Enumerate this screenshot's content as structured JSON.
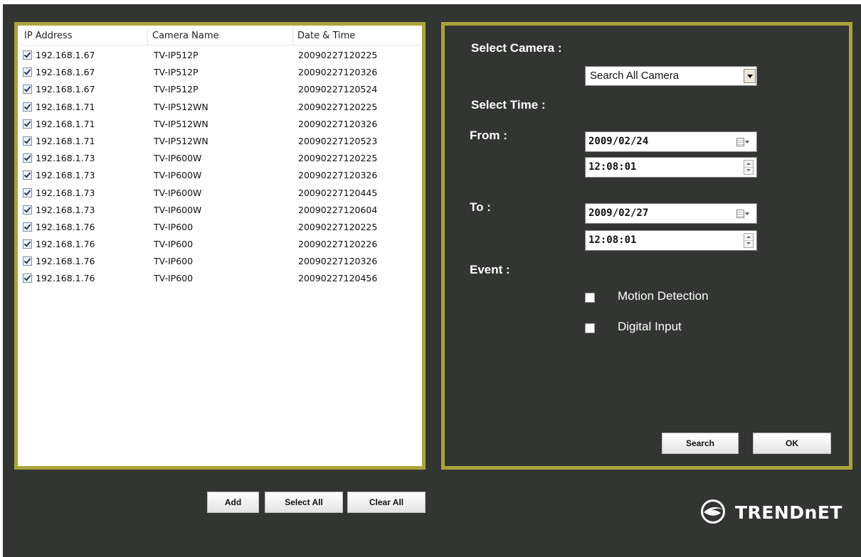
{
  "table": {
    "headers": {
      "ip": "IP Address",
      "name": "Camera Name",
      "date": "Date & Time"
    },
    "rows": [
      {
        "checked": true,
        "ip": "192.168.1.67",
        "name": "TV-IP512P",
        "date": "20090227120225"
      },
      {
        "checked": true,
        "ip": "192.168.1.67",
        "name": "TV-IP512P",
        "date": "20090227120326"
      },
      {
        "checked": true,
        "ip": "192.168.1.67",
        "name": "TV-IP512P",
        "date": "20090227120524"
      },
      {
        "checked": true,
        "ip": "192.168.1.71",
        "name": "TV-IP512WN",
        "date": "20090227120225"
      },
      {
        "checked": true,
        "ip": "192.168.1.71",
        "name": "TV-IP512WN",
        "date": "20090227120326"
      },
      {
        "checked": true,
        "ip": "192.168.1.71",
        "name": "TV-IP512WN",
        "date": "20090227120523"
      },
      {
        "checked": true,
        "ip": "192.168.1.73",
        "name": "TV-IP600W",
        "date": "20090227120225"
      },
      {
        "checked": true,
        "ip": "192.168.1.73",
        "name": "TV-IP600W",
        "date": "20090227120326"
      },
      {
        "checked": true,
        "ip": "192.168.1.73",
        "name": "TV-IP600W",
        "date": "20090227120445"
      },
      {
        "checked": true,
        "ip": "192.168.1.73",
        "name": "TV-IP600W",
        "date": "20090227120604"
      },
      {
        "checked": true,
        "ip": "192.168.1.76",
        "name": "TV-IP600",
        "date": "20090227120225"
      },
      {
        "checked": true,
        "ip": "192.168.1.76",
        "name": "TV-IP600",
        "date": "20090227120226"
      },
      {
        "checked": true,
        "ip": "192.168.1.76",
        "name": "TV-IP600",
        "date": "20090227120326"
      },
      {
        "checked": true,
        "ip": "192.168.1.76",
        "name": "TV-IP600",
        "date": "20090227120456"
      }
    ]
  },
  "list_buttons": {
    "add": "Add",
    "select_all": "Select All",
    "clear_all": "Clear All"
  },
  "search": {
    "select_camera_label": "Select Camera :",
    "camera_selected": "Search All Camera",
    "select_time_label": "Select Time :",
    "from_label": "From :",
    "from_date": "2009/02/24",
    "from_time": "12:08:01",
    "to_label": "To :",
    "to_date": "2009/02/27",
    "to_time": "12:08:01",
    "event_label": "Event :",
    "events": [
      {
        "label": "Motion Detection",
        "checked": false
      },
      {
        "label": "Digital Input",
        "checked": false
      }
    ],
    "search_button": "Search",
    "ok_button": "OK"
  },
  "brand": {
    "logo_text": "TRENDnET",
    "accent_color": "#a8a43c",
    "background_color": "#333533"
  }
}
